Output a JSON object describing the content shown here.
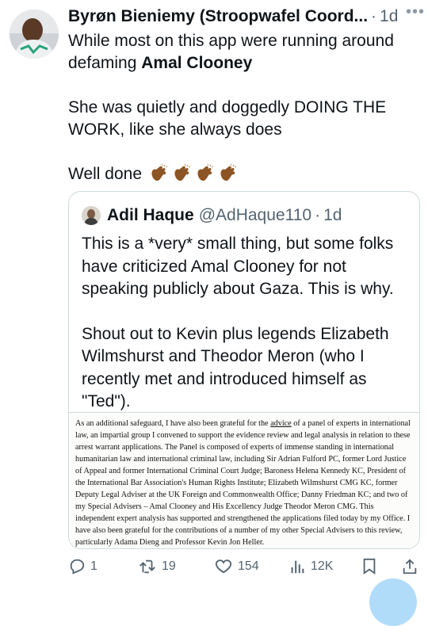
{
  "tweet": {
    "author_name": "Byrøn Bieniemy (Stroopwafel Coord...",
    "separator": "·",
    "time": "1d",
    "more_icon": "more-horizontal-icon",
    "line1": "While most on this app were running around defaming ",
    "line1_bold": "Amal Clooney",
    "para2": "She was quietly and doggedly DOING THE WORK, like she always does",
    "para3": "Well done",
    "clap_icon": "clapping-hands-icon"
  },
  "quote": {
    "author_name": "Adil Haque",
    "handle": "@AdHaque110",
    "separator": "·",
    "time": "1d",
    "para1": "This is a *very* small thing, but some folks have criticized Amal Clooney for not speaking publicly about Gaza. This is why.",
    "para2": "Shout out to Kevin plus legends Elizabeth Wilmshurst and Theodor Meron (who I recently met and introduced himself as \"Ted\").",
    "doc_before": "As an additional safeguard, I have also been grateful for the ",
    "doc_link": "advice",
    "doc_after": " of a panel of experts in international law, an impartial group I convened to support the evidence review and legal analysis in relation to these arrest warrant applications. The Panel is composed of experts of immense standing in international humanitarian law and international criminal law, including  Sir Adrian Fulford PC, former Lord Justice of Appeal and former International Criminal Court Judge; Baroness Helena Kennedy KC, President of the International Bar Association's Human Rights Institute; Elizabeth Wilmshurst CMG KC, former Deputy Legal Adviser at the UK Foreign and Commonwealth Office; Danny Friedman KC; and two of my Special Advisers – Amal Clooney and His Excellency Judge Theodor Meron CMG. This independent expert analysis has supported and strengthened the applications filed today by my Office. I have also been grateful for the contributions of a number of my other Special Advisers to this review, particularly Adama Dieng and Professor Kevin Jon Heller."
  },
  "actions": {
    "reply_count": "1",
    "retweet_count": "19",
    "like_count": "154",
    "views_count": "12K"
  },
  "colors": {
    "text": "#0f1419",
    "secondary": "#536471",
    "border": "#cfd9de",
    "accent": "#1d9bf0",
    "clap": "#8d5524"
  }
}
